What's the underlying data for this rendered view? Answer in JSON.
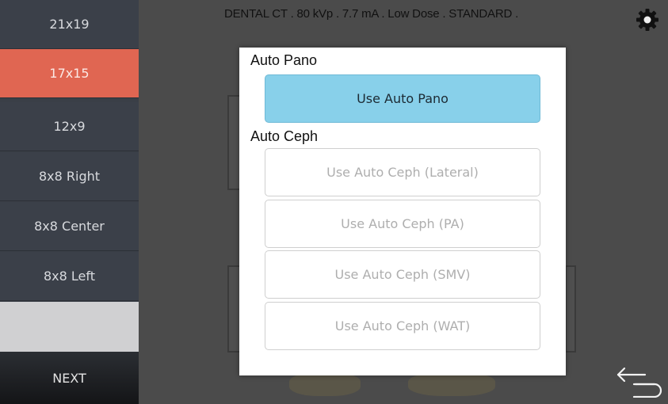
{
  "sidebar": {
    "items": [
      {
        "label": "21x19",
        "active": false
      },
      {
        "label": "17x15",
        "active": true
      },
      {
        "label": "12x9",
        "active": false
      },
      {
        "label": "8x8 Right",
        "active": false
      },
      {
        "label": "8x8 Center",
        "active": false
      },
      {
        "label": "8x8 Left",
        "active": false
      }
    ],
    "next_label": "NEXT"
  },
  "header": {
    "status": "DENTAL CT . 80 kVp . 7.7 mA . Low Dose . STANDARD ."
  },
  "icons": {
    "settings": "gear-icon",
    "back": "back-arrow-icon"
  },
  "modal": {
    "pano_title": "Auto Pano",
    "pano_option": "Use Auto Pano",
    "ceph_title": "Auto Ceph",
    "ceph_options": [
      "Use Auto Ceph (Lateral)",
      "Use Auto Ceph (PA)",
      "Use Auto Ceph (SMV)",
      "Use Auto Ceph (WAT)"
    ]
  },
  "colors": {
    "active_item": "#e06652",
    "selected_option": "#88d0ea",
    "sidebar": "#3b4049"
  }
}
